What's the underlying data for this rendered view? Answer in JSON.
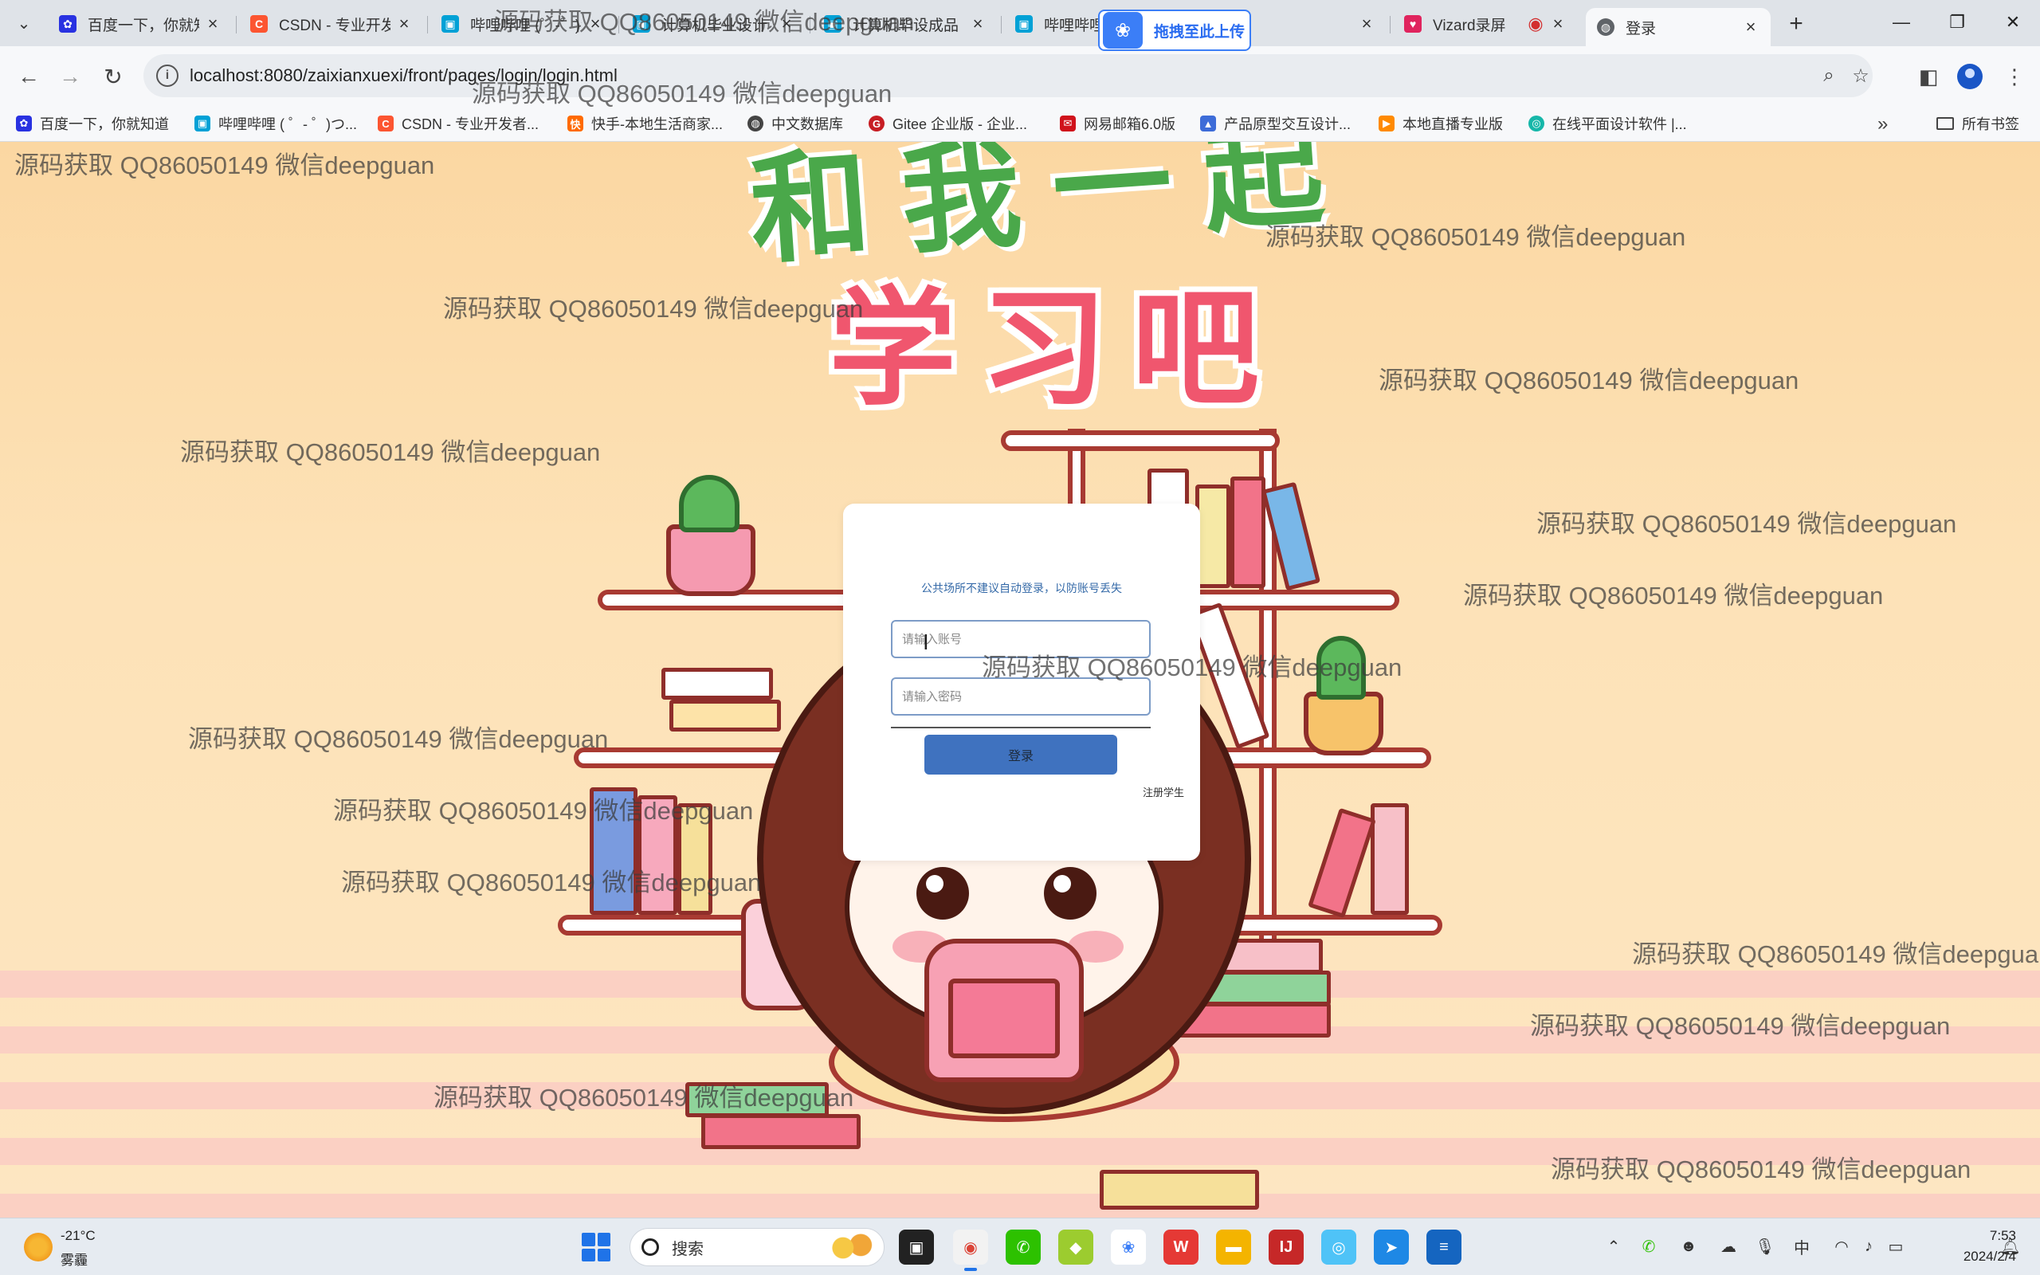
{
  "browser": {
    "tabs": [
      {
        "label": "百度一下，你就知道",
        "favicon": "paw-icon",
        "color": "#2932e1"
      },
      {
        "label": "CSDN - 专业开发者社区",
        "favicon": "csdn-icon",
        "color": "#fc5531"
      },
      {
        "label": "哔哩哔哩 (゜-゜)つロ",
        "favicon": "bilibili-icon",
        "color": "#00a1d6"
      },
      {
        "label": "计算机毕业设计",
        "favicon": "bilibili-icon",
        "color": "#00a1d6"
      },
      {
        "label": "计算机毕设成品",
        "favicon": "bilibili-icon",
        "color": "#00a1d6"
      },
      {
        "label": "哔哩哔哩 公众号",
        "favicon": "bilibili-icon",
        "color": "#00a1d6"
      },
      {
        "label": "Vizard录屏",
        "favicon": "heart-icon",
        "color": "#e0245e"
      },
      {
        "label": "登录",
        "favicon": "globe-icon",
        "color": "#5f6368",
        "active": true
      }
    ],
    "upload_pill": "拖拽至此上传",
    "url": "localhost:8080/zaixianxuexi/front/pages/login/login.html",
    "bookmarks": [
      {
        "label": "百度一下，你就知道",
        "color": "#2932e1"
      },
      {
        "label": "哔哩哔哩 ( ゜- ゜)つ...",
        "color": "#00a1d6"
      },
      {
        "label": "CSDN - 专业开发者...",
        "color": "#fc5531"
      },
      {
        "label": "快手-本地生活商家...",
        "color": "#ff6a00"
      },
      {
        "label": "中文数据库",
        "color": "#444444"
      },
      {
        "label": "Gitee 企业版 - 企业...",
        "color": "#c71d23"
      },
      {
        "label": "网易邮箱6.0版",
        "color": "#d0121b"
      },
      {
        "label": "产品原型交互设计...",
        "color": "#3d6cd8"
      },
      {
        "label": "本地直播专业版",
        "color": "#ff8a00"
      },
      {
        "label": "在线平面设计软件 |...",
        "color": "#16b7a9"
      }
    ],
    "bookmarks_folder": "所有书签"
  },
  "page": {
    "title_line1": "和我一起",
    "title_line2": "学习吧",
    "login": {
      "note": "公共场所不建议自动登录，以防账号丢失",
      "account_placeholder": "请输入账号",
      "password_placeholder": "请输入密码",
      "submit_label": "登录",
      "register_label": "注册学生"
    }
  },
  "watermark": "源码获取 QQ86050149 微信deepguan",
  "taskbar": {
    "weather_temp": "-21°C",
    "weather_cond": "雾霾",
    "search_label": "搜索",
    "time": "7:53",
    "date": "2024/2/4"
  }
}
